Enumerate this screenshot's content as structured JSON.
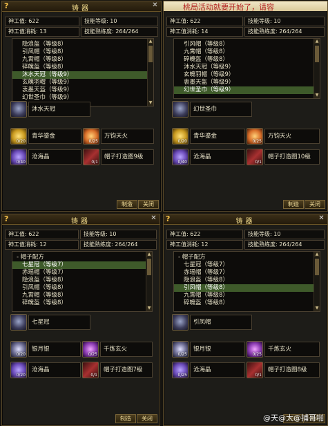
{
  "panels": [
    {
      "title": "铸器",
      "banner": "",
      "craft_value": "神工值: 622",
      "craft_cost": "神工值消耗: 13",
      "skill_level": "技能等级: 10",
      "proficiency": "技能熟练度: 264/264",
      "list": [
        "隐浪盔（等级8）",
        "引凤帽（等级8）",
        "九霄帽（等级8）",
        "碎魄盔（等级8）",
        "沐水天冠（等级9）",
        "玄魄羽帽（等级9）",
        "衷墨天盔（等级9）",
        "幻世圣巾（等级9）"
      ],
      "selected_index": 4,
      "product": "沐水天冠",
      "materials": [
        {
          "name": "青华鎏金",
          "qty": "0/20",
          "color": "gold"
        },
        {
          "name": "万钧天火",
          "qty": "0/25",
          "color": "fire"
        },
        {
          "name": "沧海晶",
          "qty": "0/40",
          "color": "purple"
        },
        {
          "name": "帽子打造图9级",
          "qty": "0/1",
          "color": "scroll"
        }
      ],
      "buttons": {
        "craft": "制造",
        "close": "关闭"
      }
    },
    {
      "title": "",
      "banner": "桃局活动就要开始了，请容",
      "craft_value": "神工值: 622",
      "craft_cost": "神工值消耗: 14",
      "skill_level": "技能等级: 10",
      "proficiency": "技能熟练度: 264/264",
      "list": [
        "引风帽（等级8）",
        "九霄帽（等级8）",
        "碎魄盔（等级8）",
        "沐水天冠（等级9）",
        "玄魄羽帽（等级9）",
        "衷墨天盔（等级9）",
        "幻世圣巾（等级9）"
      ],
      "selected_index": 6,
      "product": "幻世圣巾",
      "materials": [
        {
          "name": "青华鎏金",
          "qty": "0/20",
          "color": "gold"
        },
        {
          "name": "万钧天火",
          "qty": "0/25",
          "color": "fire"
        },
        {
          "name": "沧海晶",
          "qty": "0/40",
          "color": "purple"
        },
        {
          "name": "帽子打造图10级",
          "qty": "0/1",
          "color": "scroll"
        }
      ],
      "buttons": {
        "craft": "制造",
        "close": "关闭"
      }
    },
    {
      "title": "铸器",
      "banner": "",
      "craft_value": "神工值: 622",
      "craft_cost": "神工值消耗: 12",
      "skill_level": "技能等级: 10",
      "proficiency": "技能熟练度: 264/264",
      "list": [
        "- 帽子配方",
        "七星冠（等级7）",
        "赤瑶帽（等级7）",
        "隐浪盔（等级8）",
        "引凤帽（等级8）",
        "九霄帽（等级8）",
        "碎魄盔（等级8）"
      ],
      "selected_index": 1,
      "product": "七星冠",
      "materials": [
        {
          "name": "银月银",
          "qty": "0/20",
          "color": "silver"
        },
        {
          "name": "千炼玄火",
          "qty": "0/25",
          "color": "violet"
        },
        {
          "name": "沧海晶",
          "qty": "0/20",
          "color": "purple"
        },
        {
          "name": "帽子打造图7级",
          "qty": "0/1",
          "color": "scroll"
        }
      ],
      "buttons": {
        "craft": "制造",
        "close": "关闭"
      }
    },
    {
      "title": "铸器",
      "banner": "",
      "craft_value": "神工值: 622",
      "craft_cost": "神工值消耗: 12",
      "skill_level": "技能等级: 10",
      "proficiency": "技能熟练度: 264/264",
      "list": [
        "- 帽子配方",
        "七星冠（等级7）",
        "赤瑶帽（等级7）",
        "隐浪盔（等级8）",
        "引凤帽（等级8）",
        "九霄帽（等级8）",
        "碎魄盔（等级8）"
      ],
      "selected_index": 4,
      "product": "引凤帽",
      "materials": [
        {
          "name": "银月银",
          "qty": "0/25",
          "color": "silver"
        },
        {
          "name": "千炼玄火",
          "qty": "0/25",
          "color": "violet"
        },
        {
          "name": "沧海晶",
          "qty": "0/25",
          "color": "purple"
        },
        {
          "name": "帽子打造图8级",
          "qty": "0/1",
          "color": "scroll"
        }
      ],
      "buttons": {
        "craft": "制造",
        "close": "关闭"
      }
    }
  ],
  "watermark": "@天@大@捕哥啪",
  "colors": {
    "gold": "#c99a20",
    "fire": "#d9702a",
    "purple": "#6a4ab8",
    "scroll": "#8a2222",
    "silver": "#6a6a90",
    "violet": "#8a3ab0",
    "accent": "#f0d98a",
    "selected": "#3e5a2a"
  }
}
